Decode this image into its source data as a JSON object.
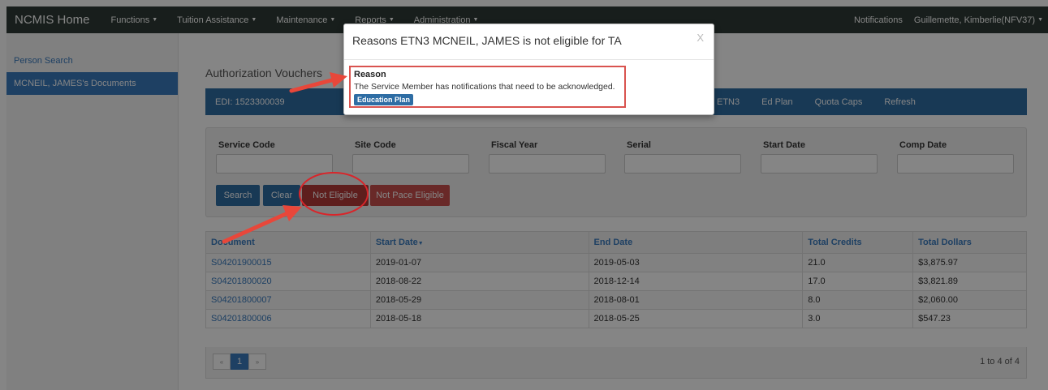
{
  "navbar": {
    "brand": "NCMIS Home",
    "items": [
      {
        "label": "Functions"
      },
      {
        "label": "Tuition Assistance"
      },
      {
        "label": "Maintenance"
      },
      {
        "label": "Reports"
      },
      {
        "label": "Administration"
      }
    ],
    "notifications": "Notifications",
    "user": "Guillemette, Kimberlie(NFV37)"
  },
  "sidebar": {
    "items": [
      {
        "label": "Person Search"
      },
      {
        "label": "MCNEIL, JAMES's Documents"
      }
    ]
  },
  "page": {
    "title": "Authorization Vouchers",
    "edi": "EDI: 1523300039",
    "bar_links": [
      "ETN3",
      "Ed Plan",
      "Quota Caps",
      "Refresh"
    ]
  },
  "search": {
    "fields": [
      {
        "label": "Service Code"
      },
      {
        "label": "Site Code"
      },
      {
        "label": "Fiscal Year"
      },
      {
        "label": "Serial"
      },
      {
        "label": "Start Date"
      },
      {
        "label": "Comp Date"
      }
    ],
    "buttons": {
      "search": "Search",
      "clear": "Clear",
      "not_eligible": "Not Eligible",
      "not_pace_eligible": "Not Pace Eligible"
    }
  },
  "table": {
    "headers": [
      "Document",
      "Start Date",
      "End Date",
      "Total Credits",
      "Total Dollars"
    ],
    "rows": [
      [
        "S04201900015",
        "2019-01-07",
        "2019-05-03",
        "21.0",
        "$3,875.97"
      ],
      [
        "S04201800020",
        "2018-08-22",
        "2018-12-14",
        "17.0",
        "$3,821.89"
      ],
      [
        "S04201800007",
        "2018-05-29",
        "2018-08-01",
        "8.0",
        "$2,060.00"
      ],
      [
        "S04201800006",
        "2018-05-18",
        "2018-05-25",
        "3.0",
        "$547.23"
      ]
    ],
    "pager": {
      "prev": "«",
      "page": "1",
      "next": "»"
    },
    "count": "1 to 4 of 4"
  },
  "modal": {
    "title": "Reasons ETN3 MCNEIL, JAMES is not eligible for TA",
    "close": "X",
    "reason_label": "Reason",
    "reason_text": "The Service Member has notifications that need to be acknowledged.",
    "button": "Education Plan"
  },
  "colors": {
    "navbar": "#2f3b36",
    "primary": "#2e6da4",
    "danger": "#b43a38",
    "annotation": "#e8473a"
  }
}
